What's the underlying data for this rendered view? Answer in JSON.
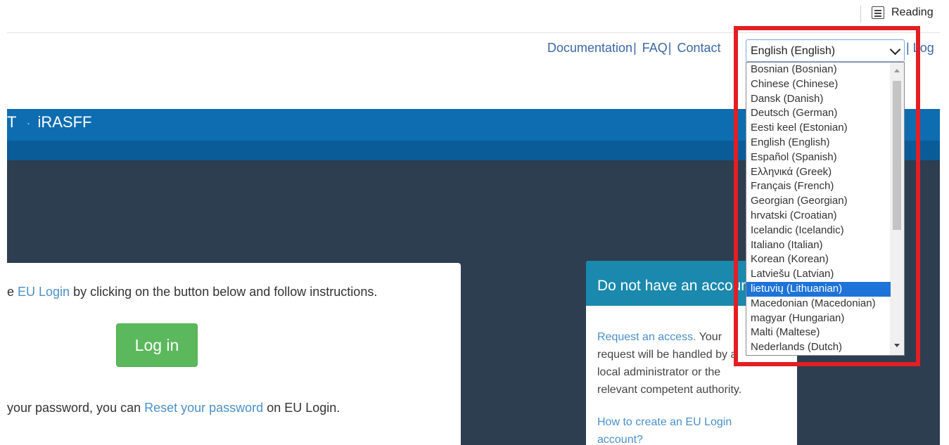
{
  "browser": {
    "reading_label": "Reading"
  },
  "nav": {
    "links": [
      "Documentation",
      "FAQ",
      "Contact"
    ],
    "separator": "|",
    "after_select_text": "| Log"
  },
  "brand": {
    "prefix": "T",
    "name": "iRASFF"
  },
  "language_select": {
    "value": "English (English)",
    "options": [
      "Bosnian (Bosnian)",
      "Chinese (Chinese)",
      "Dansk (Danish)",
      "Deutsch (German)",
      "Eesti keel (Estonian)",
      "English (English)",
      "Español (Spanish)",
      "Ελληνικά (Greek)",
      "Français (French)",
      "Georgian (Georgian)",
      "hrvatski (Croatian)",
      "Icelandic (Icelandic)",
      "Italiano (Italian)",
      "Korean (Korean)",
      "Latviešu (Latvian)",
      "lietuvių (Lithuanian)",
      "Macedonian (Macedonian)",
      "magyar (Hungarian)",
      "Malti (Maltese)",
      "Nederlands (Dutch)"
    ],
    "highlighted_option": "lietuvių (Lithuanian)"
  },
  "login": {
    "intro_pre": "e ",
    "intro_link": "EU Login",
    "intro_post": " by clicking on the button below and follow instructions.",
    "button_label": "Log in",
    "reset_pre": " your password, you can ",
    "reset_link": "Reset your password",
    "reset_post": " on EU Login."
  },
  "account": {
    "heading": "Do not have an account?",
    "request_link": "Request an access.",
    "request_text": " Your request will be handled by a local administrator or the relevant competent authority.",
    "howto_link": "How to create an EU Login account?"
  },
  "colors": {
    "brand_blue": "#0e6db0",
    "dark_bg": "#2d3e50",
    "login_green": "#5cb85c",
    "account_header": "#1a89ad",
    "selection_blue": "#1e73d8",
    "highlight_red": "#e31e24"
  }
}
